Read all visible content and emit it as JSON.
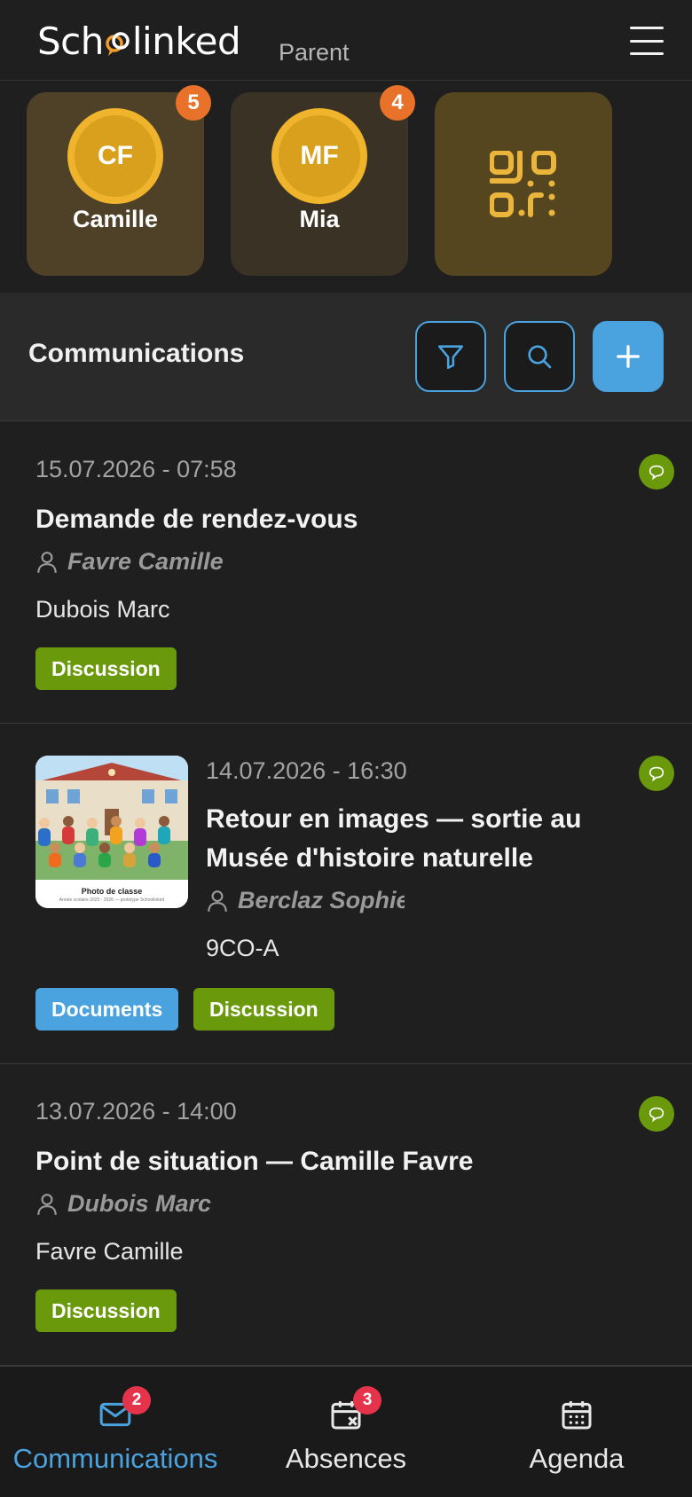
{
  "app": {
    "logo_text_left": "Sch",
    "logo_text_right": "linked",
    "role": "Parent",
    "accent_color": "#4aa3df"
  },
  "students": [
    {
      "initials": "CF",
      "name": "Camille",
      "badge": "5"
    },
    {
      "initials": "MF",
      "name": "Mia",
      "badge": "4"
    }
  ],
  "qr_card": {
    "icon": "qr-code-icon"
  },
  "toolbar": {
    "title": "Communications",
    "filter_icon": "filter-icon",
    "search_icon": "search-icon",
    "add_icon": "plus-icon"
  },
  "messages": [
    {
      "date": "15.07.2026 - 07:58",
      "subject": "Demande de rendez-vous",
      "author": "Favre Camille",
      "recipient": "Dubois Marc",
      "tags": [
        "Discussion"
      ]
    },
    {
      "date": "14.07.2026 - 16:30",
      "subject_line1": "Retour en images — sortie au",
      "subject_line2": "Musée d'histoire naturelle",
      "author": "Berclaz Sophie",
      "recipient": "9CO-A",
      "tags": [
        "Documents",
        "Discussion"
      ],
      "thumbnail_caption": "Photo de classe",
      "thumbnail_subcaption": "Année scolaire 2025 - 2026 — prototype Schoolinked"
    },
    {
      "date": "13.07.2026 - 14:00",
      "subject": "Point de situation — Camille Favre",
      "author": "Dubois Marc",
      "recipient": "Favre Camille",
      "tags": [
        "Discussion"
      ]
    }
  ],
  "bottom_nav": [
    {
      "label": "Communications",
      "badge": "2",
      "icon": "mail-icon",
      "active": true
    },
    {
      "label": "Absences",
      "badge": "3",
      "icon": "calendar-x-icon",
      "active": false
    },
    {
      "label": "Agenda",
      "icon": "calendar-icon",
      "active": false
    }
  ]
}
